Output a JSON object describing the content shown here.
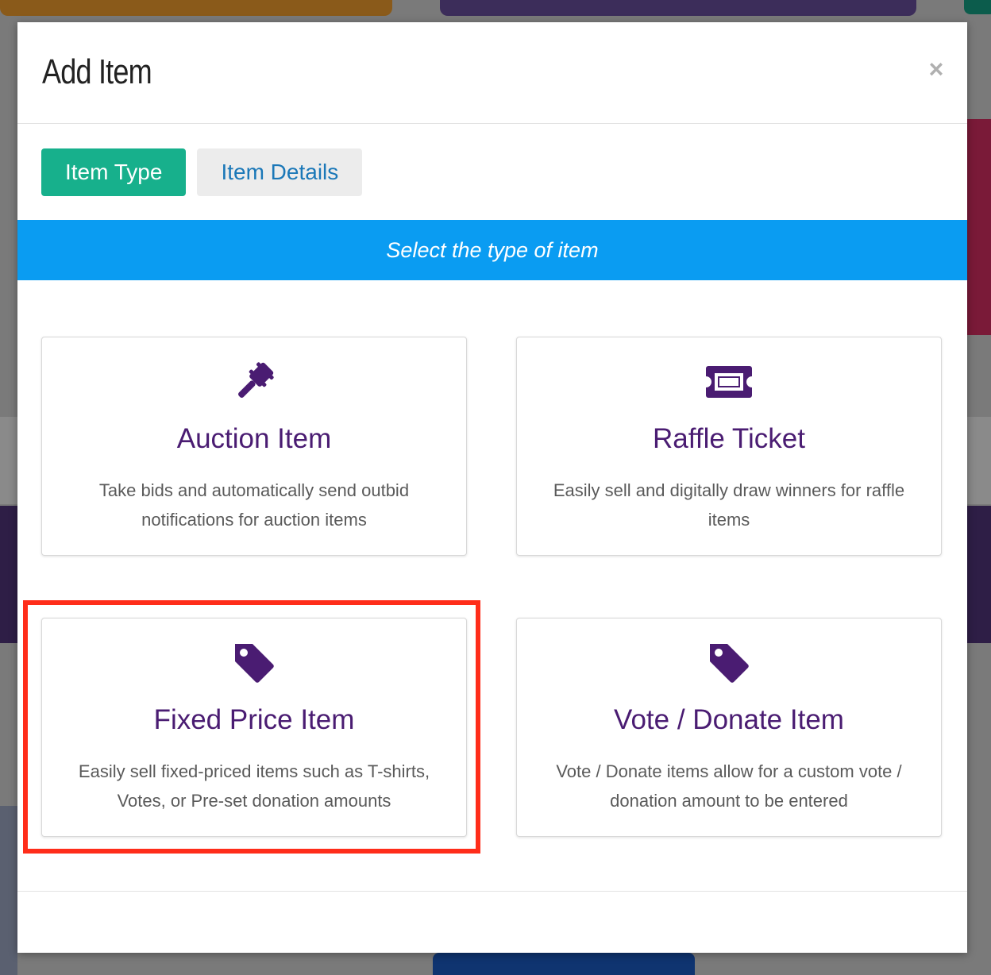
{
  "modal": {
    "title": "Add Item",
    "close_label": "×"
  },
  "tabs": [
    {
      "label": "Item Type",
      "active": true
    },
    {
      "label": "Item Details",
      "active": false
    }
  ],
  "banner": {
    "text": "Select the type of item"
  },
  "item_types": [
    {
      "title": "Auction Item",
      "description": "Take bids and automatically send outbid notifications for auction items",
      "icon": "gavel-icon"
    },
    {
      "title": "Raffle Ticket",
      "description": "Easily sell and digitally draw winners for raffle items",
      "icon": "ticket-icon"
    },
    {
      "title": "Fixed Price Item",
      "description": "Easily sell fixed-priced items such as T-shirts, Votes, or Pre-set donation amounts",
      "icon": "tag-icon",
      "highlighted": true
    },
    {
      "title": "Vote / Donate Item",
      "description": "Vote / Donate items allow for a custom vote / donation amount to be entered",
      "icon": "tag-icon"
    }
  ],
  "colors": {
    "tab_active": "#17b08c",
    "tab_inactive_text": "#1b78b8",
    "banner": "#0a9cf2",
    "card_title": "#4a1c72",
    "icon": "#4a1c72",
    "highlight": "#ff2d1a"
  }
}
